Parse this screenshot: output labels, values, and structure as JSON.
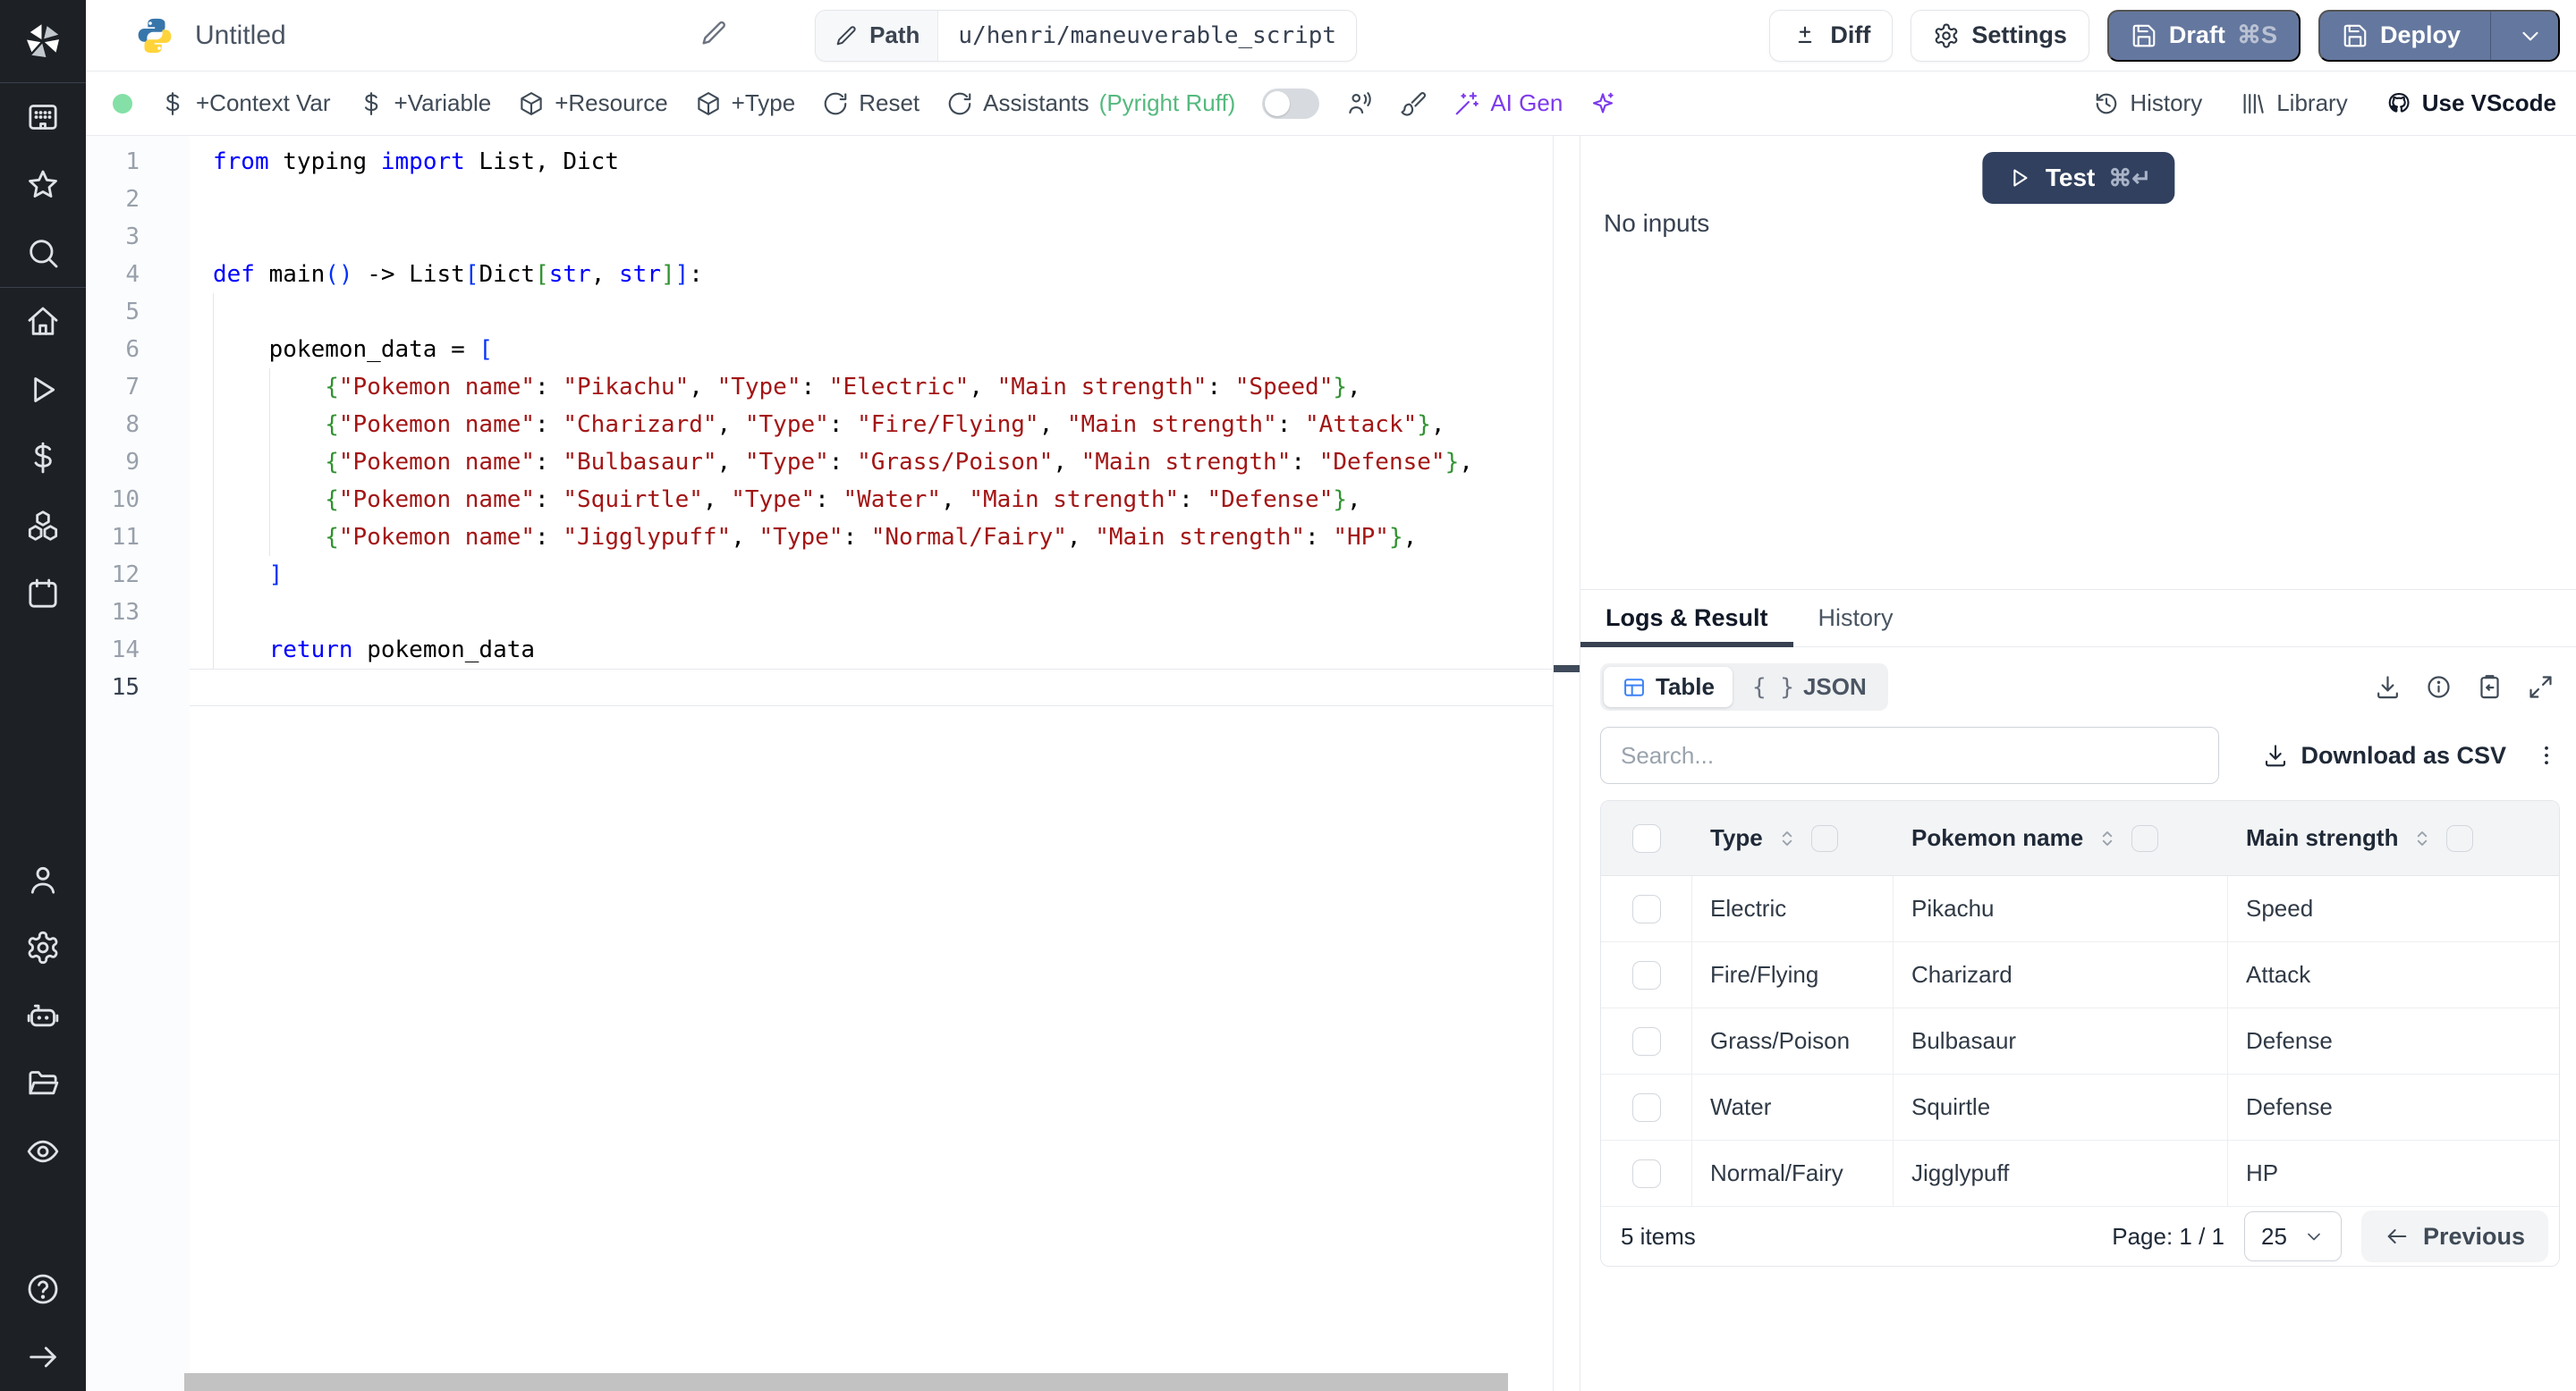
{
  "colors": {
    "accent_slate": "#64779e",
    "test_button": "#31405f",
    "ai_purple": "#7c3aed",
    "status_green": "#84e0a6",
    "table_icon_blue": "#3b82f6",
    "sidebar_bg": "#1d2126"
  },
  "sidebar": {
    "groups": [
      [
        "windmill-logo"
      ],
      [
        "apps-icon",
        "star-icon",
        "search-icon"
      ],
      [
        "home-icon",
        "runs-icon",
        "variables-icon",
        "resources-icon",
        "schedules-icon"
      ],
      [
        "user-icon",
        "settings-icon",
        "workers-icon",
        "folders-icon",
        "audit-icon"
      ],
      [
        "help-icon",
        "expand-sidebar-icon"
      ]
    ]
  },
  "header": {
    "title": "Untitled",
    "path_label": "Path",
    "path_value": "u/henri/maneuverable_script",
    "diff_label": "Diff",
    "settings_label": "Settings",
    "draft_label": "Draft",
    "draft_shortcut": "⌘S",
    "deploy_label": "Deploy"
  },
  "toolbar": {
    "add_context_var": "+Context Var",
    "add_variable": "+Variable",
    "add_resource": "+Resource",
    "add_type": "+Type",
    "reset": "Reset",
    "assistants": "Assistants",
    "assistants_detail": "(Pyright Ruff)",
    "ai_gen": "AI Gen",
    "history": "History",
    "library": "Library",
    "use_vscode": "Use VScode"
  },
  "editor": {
    "active_line": 15,
    "lines": [
      [
        [
          "k",
          "from"
        ],
        [
          "d",
          " typing "
        ],
        [
          "k",
          "import"
        ],
        [
          "d",
          " List, Dict"
        ]
      ],
      [],
      [],
      [
        [
          "k",
          "def"
        ],
        [
          "d",
          " main"
        ],
        [
          "b",
          "()"
        ],
        [
          "d",
          " -> List"
        ],
        [
          "b",
          "["
        ],
        [
          "d",
          "Dict"
        ],
        [
          "g",
          "["
        ],
        [
          "k",
          "str"
        ],
        [
          "d",
          ", "
        ],
        [
          "k",
          "str"
        ],
        [
          "g",
          "]"
        ],
        [
          "b",
          "]"
        ],
        [
          "d",
          ":"
        ]
      ],
      [],
      [
        [
          "d",
          "    pokemon_data = "
        ],
        [
          "b",
          "["
        ]
      ],
      [
        [
          "d",
          "        "
        ],
        [
          "g",
          "{"
        ],
        [
          "s",
          "\"Pokemon name\""
        ],
        [
          "d",
          ": "
        ],
        [
          "s",
          "\"Pikachu\""
        ],
        [
          "d",
          ", "
        ],
        [
          "s",
          "\"Type\""
        ],
        [
          "d",
          ": "
        ],
        [
          "s",
          "\"Electric\""
        ],
        [
          "d",
          ", "
        ],
        [
          "s",
          "\"Main strength\""
        ],
        [
          "d",
          ": "
        ],
        [
          "s",
          "\"Speed\""
        ],
        [
          "g",
          "}"
        ],
        [
          "d",
          ","
        ]
      ],
      [
        [
          "d",
          "        "
        ],
        [
          "g",
          "{"
        ],
        [
          "s",
          "\"Pokemon name\""
        ],
        [
          "d",
          ": "
        ],
        [
          "s",
          "\"Charizard\""
        ],
        [
          "d",
          ", "
        ],
        [
          "s",
          "\"Type\""
        ],
        [
          "d",
          ": "
        ],
        [
          "s",
          "\"Fire/Flying\""
        ],
        [
          "d",
          ", "
        ],
        [
          "s",
          "\"Main strength\""
        ],
        [
          "d",
          ": "
        ],
        [
          "s",
          "\"Attack\""
        ],
        [
          "g",
          "}"
        ],
        [
          "d",
          ","
        ]
      ],
      [
        [
          "d",
          "        "
        ],
        [
          "g",
          "{"
        ],
        [
          "s",
          "\"Pokemon name\""
        ],
        [
          "d",
          ": "
        ],
        [
          "s",
          "\"Bulbasaur\""
        ],
        [
          "d",
          ", "
        ],
        [
          "s",
          "\"Type\""
        ],
        [
          "d",
          ": "
        ],
        [
          "s",
          "\"Grass/Poison\""
        ],
        [
          "d",
          ", "
        ],
        [
          "s",
          "\"Main strength\""
        ],
        [
          "d",
          ": "
        ],
        [
          "s",
          "\"Defense\""
        ],
        [
          "g",
          "}"
        ],
        [
          "d",
          ","
        ]
      ],
      [
        [
          "d",
          "        "
        ],
        [
          "g",
          "{"
        ],
        [
          "s",
          "\"Pokemon name\""
        ],
        [
          "d",
          ": "
        ],
        [
          "s",
          "\"Squirtle\""
        ],
        [
          "d",
          ", "
        ],
        [
          "s",
          "\"Type\""
        ],
        [
          "d",
          ": "
        ],
        [
          "s",
          "\"Water\""
        ],
        [
          "d",
          ", "
        ],
        [
          "s",
          "\"Main strength\""
        ],
        [
          "d",
          ": "
        ],
        [
          "s",
          "\"Defense\""
        ],
        [
          "g",
          "}"
        ],
        [
          "d",
          ","
        ]
      ],
      [
        [
          "d",
          "        "
        ],
        [
          "g",
          "{"
        ],
        [
          "s",
          "\"Pokemon name\""
        ],
        [
          "d",
          ": "
        ],
        [
          "s",
          "\"Jigglypuff\""
        ],
        [
          "d",
          ", "
        ],
        [
          "s",
          "\"Type\""
        ],
        [
          "d",
          ": "
        ],
        [
          "s",
          "\"Normal/Fairy\""
        ],
        [
          "d",
          ", "
        ],
        [
          "s",
          "\"Main strength\""
        ],
        [
          "d",
          ": "
        ],
        [
          "s",
          "\"HP\""
        ],
        [
          "g",
          "}"
        ],
        [
          "d",
          ","
        ]
      ],
      [
        [
          "d",
          "    "
        ],
        [
          "b",
          "]"
        ]
      ],
      [],
      [
        [
          "d",
          "    "
        ],
        [
          "k",
          "return"
        ],
        [
          "d",
          " pokemon_data"
        ]
      ],
      []
    ]
  },
  "run_panel": {
    "test_label": "Test",
    "test_shortcut": "⌘↵",
    "no_inputs": "No inputs",
    "tabs": {
      "logs": "Logs & Result",
      "history": "History"
    },
    "view_toggle": {
      "table": "Table",
      "json": "JSON",
      "braces_glyph": "{ }"
    },
    "search_placeholder": "Search...",
    "download_csv": "Download as CSV",
    "table": {
      "columns": [
        "Type",
        "Pokemon name",
        "Main strength"
      ],
      "rows": [
        [
          "Electric",
          "Pikachu",
          "Speed"
        ],
        [
          "Fire/Flying",
          "Charizard",
          "Attack"
        ],
        [
          "Grass/Poison",
          "Bulbasaur",
          "Defense"
        ],
        [
          "Water",
          "Squirtle",
          "Defense"
        ],
        [
          "Normal/Fairy",
          "Jigglypuff",
          "HP"
        ]
      ],
      "items_count": "5 items",
      "page_label": "Page: 1 / 1",
      "page_size": "25",
      "previous_label": "Previous"
    }
  }
}
